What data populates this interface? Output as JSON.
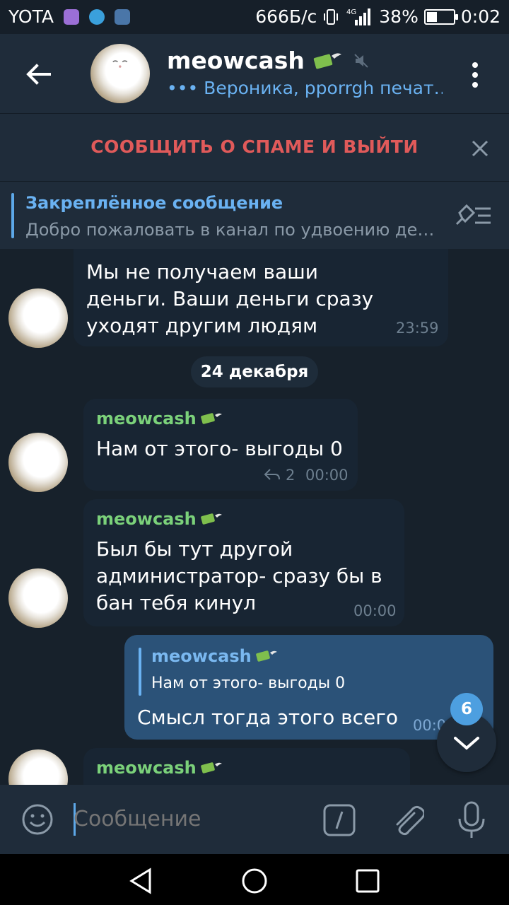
{
  "status_bar": {
    "carrier": "YOTA",
    "speed": "666Б/с",
    "network": "4G",
    "battery": "38%",
    "battery_level": 0.38,
    "time": "0:02"
  },
  "header": {
    "title": "meowcash",
    "subtitle": "••• Вероника, pporrgh печат…"
  },
  "spam_bar": {
    "label": "СООБЩИТЬ О СПАМЕ И ВЫЙТИ"
  },
  "pinned": {
    "title": "Закреплённое сообщение",
    "text": "Добро пожаловать в канал по удвоению де…"
  },
  "messages": [
    {
      "lines": [
        "Мы не получаем ваши",
        "деньги. Ваши деньги сразу",
        "уходят другим людям"
      ],
      "time": "23:59"
    },
    {
      "sender": "meowcash",
      "lines": [
        "Нам от этого- выгоды 0"
      ],
      "replies": "2",
      "time": "00:00"
    },
    {
      "sender": "meowcash",
      "lines": [
        "Был бы тут другой",
        "администратор- сразу бы в",
        "бан тебя кинул"
      ],
      "time": "00:00"
    },
    {
      "reply_to_name": "meowcash",
      "reply_to_text": "Нам от этого- выгоды 0",
      "lines": [
        "Смысл тогда этого всего"
      ],
      "time": "00:0"
    },
    {
      "sender": "meowcash"
    }
  ],
  "date_separator": "24 декабря",
  "unread_count": "6",
  "input": {
    "placeholder": "Сообщение"
  },
  "colors": {
    "accent": "#6ab2f2",
    "sender_name": "#7bd17a",
    "spam": "#e05a5a",
    "background": "#17212b"
  }
}
